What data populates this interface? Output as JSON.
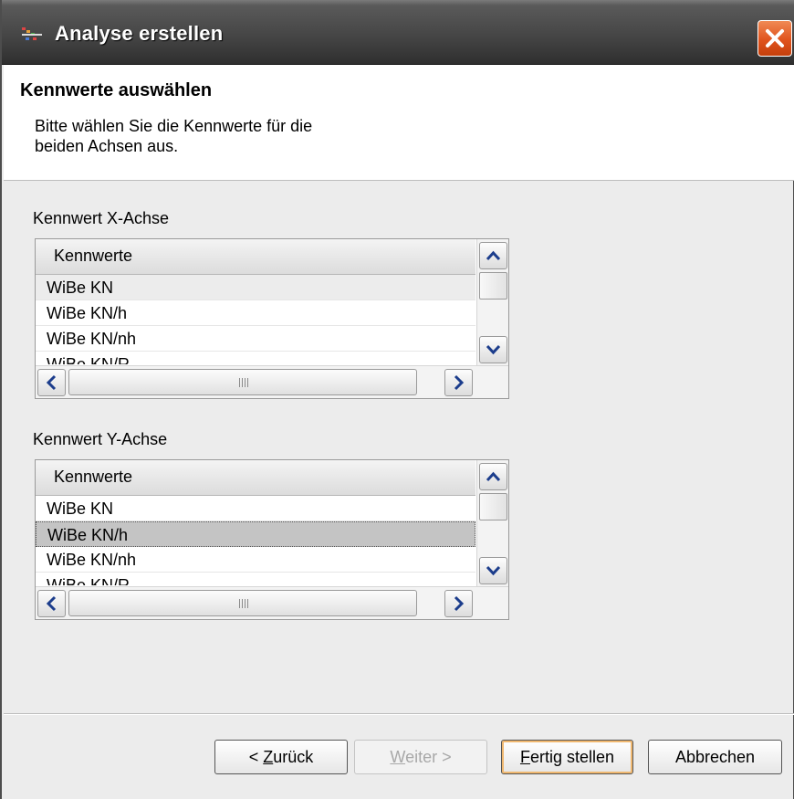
{
  "window": {
    "title": "Analyse erstellen",
    "close_icon": "close-icon"
  },
  "header": {
    "title": "Kennwerte auswählen",
    "description_line1": "Bitte wählen Sie die Kennwerte für die",
    "description_line2": "beiden Achsen aus."
  },
  "x_axis": {
    "label": "Kennwert X-Achse",
    "column_header": "Kennwerte",
    "rows": [
      "WiBe KN",
      "WiBe KN/h",
      "WiBe KN/nh",
      "WiBe KN/R"
    ],
    "hovered_index": 0,
    "selected_index": null
  },
  "y_axis": {
    "label": "Kennwert Y-Achse",
    "column_header": "Kennwerte",
    "rows": [
      "WiBe KN",
      "WiBe KN/h",
      "WiBe KN/nh",
      "WiBe KN/R"
    ],
    "selected_index": 1
  },
  "buttons": {
    "back": {
      "prefix": "< ",
      "mnemonic": "Z",
      "rest": "urück"
    },
    "next": {
      "mnemonic": "W",
      "rest": "eiter >",
      "disabled": true
    },
    "finish": {
      "mnemonic": "F",
      "rest": "ertig stellen",
      "default": true
    },
    "cancel": {
      "label": "Abbrechen"
    }
  },
  "colors": {
    "close_button": "#e0531d",
    "selection": "#c4c4c4",
    "default_button_glow": "#f0b870"
  }
}
